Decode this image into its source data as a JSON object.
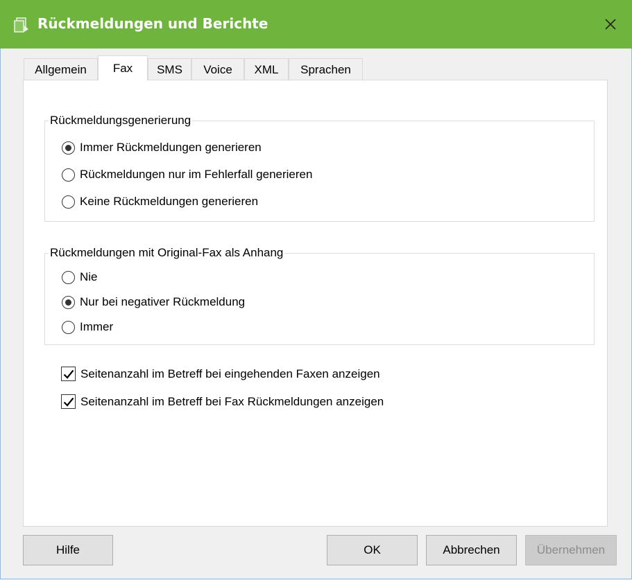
{
  "window": {
    "title": "Rückmeldungen und Berichte",
    "accent_color": "#6fb43c",
    "icon": "document-icon"
  },
  "tabs": [
    {
      "label": "Allgemein",
      "active": false
    },
    {
      "label": "Fax",
      "active": true
    },
    {
      "label": "SMS",
      "active": false
    },
    {
      "label": "Voice",
      "active": false
    },
    {
      "label": "XML",
      "active": false
    },
    {
      "label": "Sprachen",
      "active": false
    }
  ],
  "group_feedback": {
    "legend": "Rückmeldungsgenerierung",
    "options": [
      {
        "label": "Immer Rückmeldungen generieren",
        "selected": true
      },
      {
        "label": "Rückmeldungen nur im Fehlerfall generieren",
        "selected": false
      },
      {
        "label": "Keine Rückmeldungen generieren",
        "selected": false
      }
    ]
  },
  "group_attachment": {
    "legend": "Rückmeldungen mit Original-Fax als Anhang",
    "options": [
      {
        "label": "Nie",
        "selected": false
      },
      {
        "label": "Nur bei negativer Rückmeldung",
        "selected": true
      },
      {
        "label": "Immer",
        "selected": false
      }
    ]
  },
  "checkboxes": [
    {
      "label": "Seitenanzahl im Betreff bei eingehenden Faxen anzeigen",
      "checked": true
    },
    {
      "label": "Seitenanzahl im Betreff bei Fax Rückmeldungen anzeigen",
      "checked": true
    }
  ],
  "buttons": {
    "help": "Hilfe",
    "ok": "OK",
    "cancel": "Abbrechen",
    "apply": "Übernehmen",
    "apply_disabled": true
  }
}
